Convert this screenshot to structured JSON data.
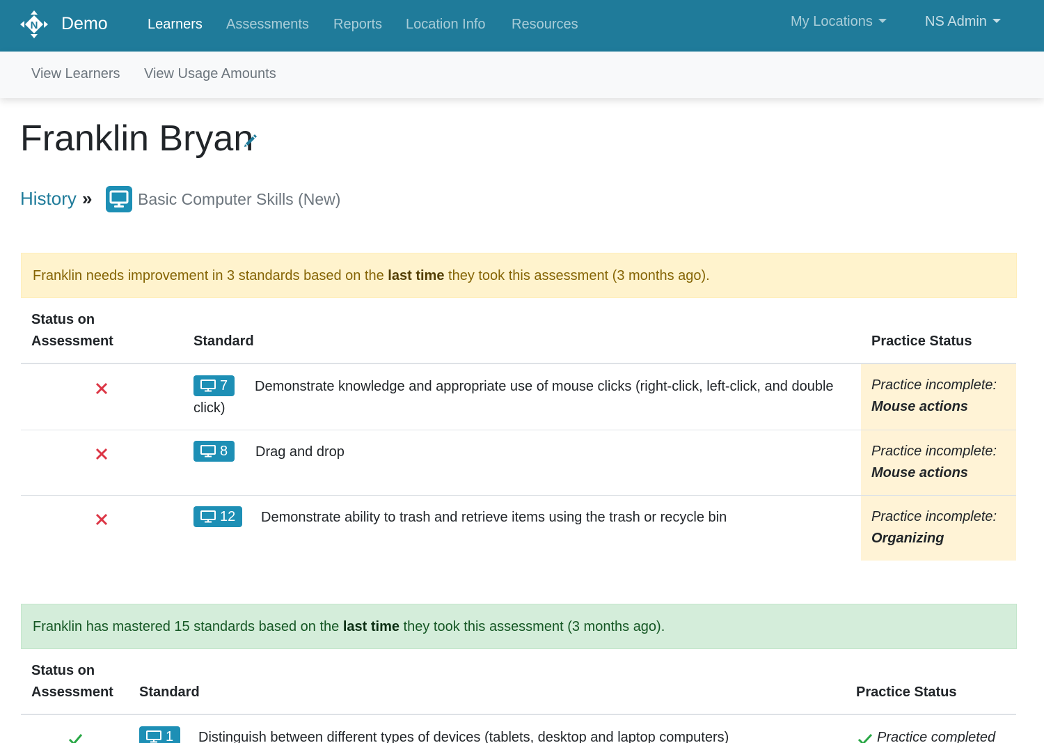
{
  "navbar": {
    "brand": "Demo",
    "links": [
      "Learners",
      "Assessments",
      "Reports",
      "Location Info",
      "Resources"
    ],
    "active_link": "Learners",
    "locations_dropdown": "My Locations",
    "user_dropdown": "NS Admin",
    "colors": {
      "bar": "#1f7b9a",
      "accent": "#1d8fb5"
    }
  },
  "subnav": {
    "links": [
      "View Learners",
      "View Usage Amounts"
    ]
  },
  "page": {
    "title": "Franklin Bryan",
    "breadcrumb": {
      "link": "History",
      "separator": "»",
      "current": "Basic Computer Skills (New)",
      "icon": "monitor-icon"
    }
  },
  "needs_improvement": {
    "alert": {
      "before": "Franklin needs improvement in 3 standards based on the ",
      "bold": "last time",
      "after": " they took this assessment (3 months ago)."
    },
    "headers": {
      "status_line1": "Status on",
      "status_line2": "Assessment",
      "standard": "Standard",
      "practice": "Practice Status"
    },
    "rows": [
      {
        "number": "7",
        "text": "Demonstrate knowledge and appropriate use of mouse clicks (right-click, left-click, and double click)",
        "practice_prefix": "Practice incomplete:",
        "practice_topic": "Mouse actions"
      },
      {
        "number": "8",
        "text": "Drag and drop",
        "practice_prefix": "Practice incomplete:",
        "practice_topic": "Mouse actions"
      },
      {
        "number": "12",
        "text": "Demonstrate ability to trash and retrieve items using the trash or recycle bin",
        "practice_prefix": "Practice incomplete:",
        "practice_topic": "Organizing"
      }
    ]
  },
  "mastered": {
    "alert": {
      "before": "Franklin has mastered 15 standards based on the ",
      "bold": "last time",
      "after": " they took this assessment (3 months ago)."
    },
    "headers": {
      "status_line1": "Status on",
      "status_line2": "Assessment",
      "standard": "Standard",
      "practice": "Practice Status"
    },
    "rows": [
      {
        "number": "1",
        "text": "Distinguish between different types of devices (tablets, desktop and laptop computers)",
        "practice_status": "Practice completed"
      }
    ]
  }
}
